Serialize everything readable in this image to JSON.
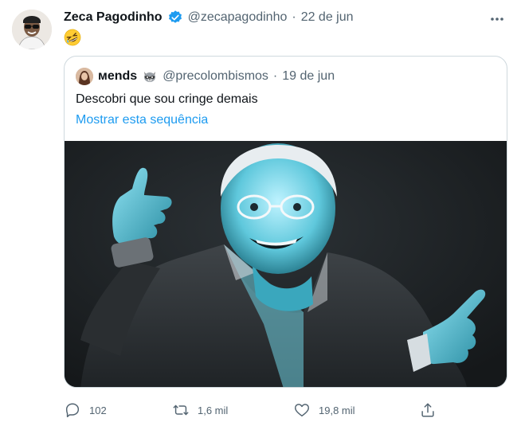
{
  "author": {
    "name": "Zeca Pagodinho",
    "handle": "@zecapagodinho",
    "separator": "·",
    "date": "22 de jun",
    "emoji": "rolling-on-floor-laughing-emoji"
  },
  "quote": {
    "name": "ᴍends",
    "name_emoji": "raccoon-emoji",
    "handle": "@precolombismos",
    "separator": "·",
    "date": "19 de jun",
    "text": "Descobri que sou cringe demais",
    "thread_link": "Mostrar esta sequência"
  },
  "actions": {
    "replies": "102",
    "retweets": "1,6 mil",
    "likes": "19,8 mil"
  },
  "colors": {
    "accent": "#1d9bf0",
    "muted": "#536471",
    "border": "#cfd9de"
  }
}
